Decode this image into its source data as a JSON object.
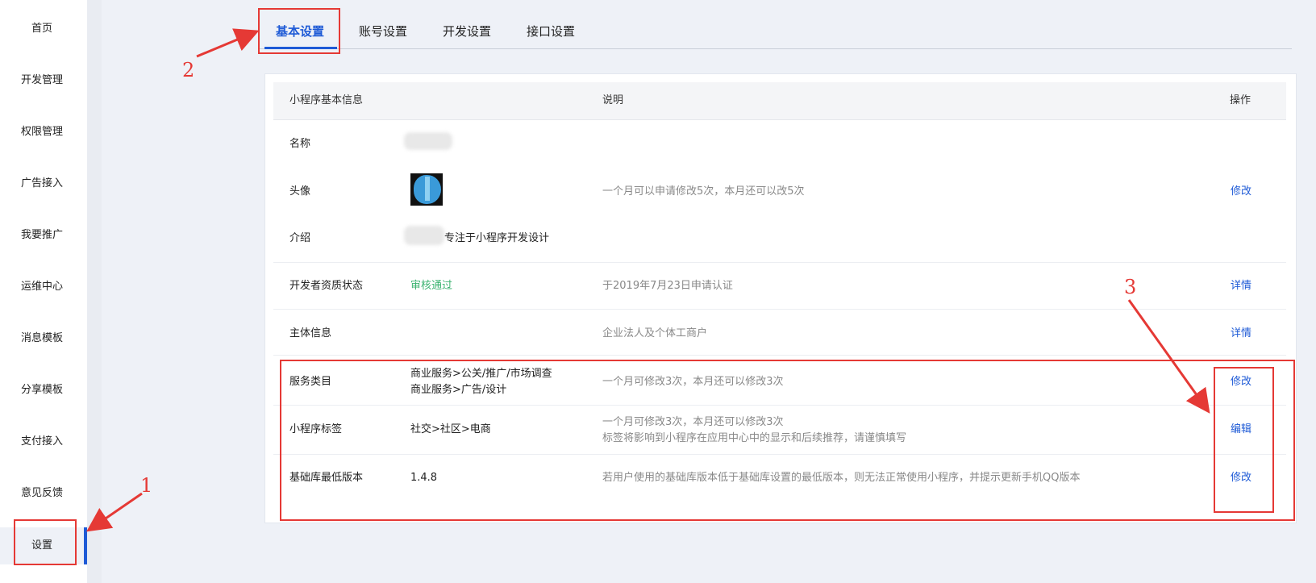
{
  "sidebar": {
    "items": [
      {
        "label": "首页"
      },
      {
        "label": "开发管理"
      },
      {
        "label": "权限管理"
      },
      {
        "label": "广告接入"
      },
      {
        "label": "我要推广"
      },
      {
        "label": "运维中心"
      },
      {
        "label": "消息模板"
      },
      {
        "label": "分享模板"
      },
      {
        "label": "支付接入"
      },
      {
        "label": "意见反馈"
      },
      {
        "label": "设置"
      }
    ]
  },
  "tabs": [
    {
      "label": "基本设置"
    },
    {
      "label": "账号设置"
    },
    {
      "label": "开发设置"
    },
    {
      "label": "接口设置"
    }
  ],
  "table": {
    "headers": {
      "info": "小程序基本信息",
      "desc": "说明",
      "op": "操作"
    },
    "rows": {
      "name": {
        "label": "名称"
      },
      "avatar": {
        "label": "头像",
        "desc": "一个月可以申请修改5次，本月还可以改5次",
        "op": "修改"
      },
      "intro": {
        "label": "介绍",
        "value": "专注于小程序开发设计"
      },
      "dev_status": {
        "label": "开发者资质状态",
        "value": "审核通过",
        "desc": "于2019年7月23日申请认证",
        "op": "详情"
      },
      "subject": {
        "label": "主体信息",
        "desc": "企业法人及个体工商户",
        "op": "详情"
      },
      "category": {
        "label": "服务类目",
        "value_line1": "商业服务>公关/推广/市场调查",
        "value_line2": "商业服务>广告/设计",
        "desc": "一个月可修改3次，本月还可以修改3次",
        "op": "修改"
      },
      "tags": {
        "label": "小程序标签",
        "value": "社交>社区>电商",
        "desc_line1": "一个月可修改3次，本月还可以修改3次",
        "desc_line2": "标签将影响到小程序在应用中心中的显示和后续推荐，请谨慎填写",
        "op": "编辑"
      },
      "base_lib": {
        "label": "基础库最低版本",
        "value": "1.4.8",
        "desc": "若用户使用的基础库版本低于基础库设置的最低版本，则无法正常使用小程序，并提示更新手机QQ版本",
        "op": "修改"
      }
    }
  },
  "annotations": {
    "n1": "1",
    "n2": "2",
    "n3": "3"
  },
  "colors": {
    "accent": "#1e5ad6",
    "annotation": "#e53935",
    "success": "#3cb371"
  }
}
